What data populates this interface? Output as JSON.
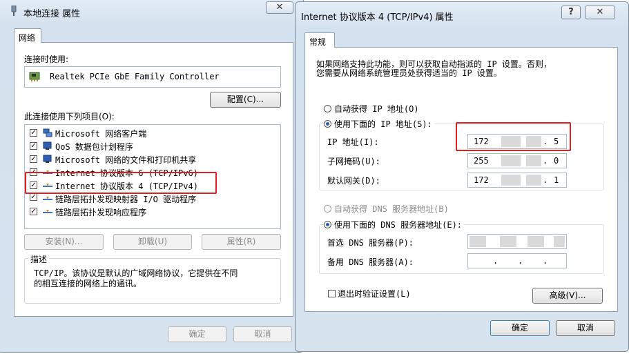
{
  "left": {
    "title": "本地连接 属性",
    "close_glyph": "✕",
    "tab": "网络",
    "connect_using_label": "连接时使用:",
    "adapter_name": "Realtek PCIe GbE Family Controller",
    "configure_button": "配置(C)...",
    "items_label": "此连接使用下列项目(O):",
    "items": [
      {
        "label": "Microsoft 网络客户端",
        "checked": true,
        "icon": "network-client-icon"
      },
      {
        "label": "QoS 数据包计划程序",
        "checked": true,
        "icon": "qos-icon"
      },
      {
        "label": "Microsoft 网络的文件和打印机共享",
        "checked": true,
        "icon": "file-printer-share-icon"
      },
      {
        "label": "Internet 协议版本 6 (TCP/IPv6)",
        "checked": true,
        "icon": "protocol-icon"
      },
      {
        "label": "Internet 协议版本 4 (TCP/IPv4)",
        "checked": true,
        "icon": "protocol-icon"
      },
      {
        "label": "链路层拓扑发现映射器 I/O 驱动程序",
        "checked": true,
        "icon": "protocol-icon"
      },
      {
        "label": "链路层拓扑发现响应程序",
        "checked": true,
        "icon": "protocol-icon"
      }
    ],
    "install_button": "安装(N)...",
    "uninstall_button": "卸载(U)",
    "properties_button": "属性(R)",
    "description_label": "描述",
    "description_text_1": "TCP/IP。该协议是默认的广域网络协议，它提供在不同",
    "description_text_2": "的相互连接的网络上的通讯。",
    "ok_button": "确定",
    "cancel_button": "取消"
  },
  "right": {
    "title": "Internet 协议版本 4 (TCP/IPv4) 属性",
    "help_glyph": "?",
    "close_glyph": "✕",
    "tab": "常规",
    "intro_1": "如果网络支持此功能，则可以获取自动指派的 IP 设置。否则，",
    "intro_2": "您需要从网络系统管理员处获得适当的 IP 设置。",
    "auto_ip_label": "自动获得 IP 地址(O)",
    "manual_ip_label": "使用下面的 IP 地址(S):",
    "ip_label": "IP 地址(I):",
    "ip_first": "172",
    "ip_last": "5",
    "subnet_label": "子网掩码(U):",
    "subnet_first": "255",
    "subnet_last": "0",
    "gateway_label": "默认网关(D):",
    "gateway_first": "172",
    "gateway_last": "1",
    "auto_dns_label": "自动获得 DNS 服务器地址(B)",
    "manual_dns_label": "使用下面的 DNS 服务器地址(E):",
    "preferred_dns_label": "首选 DNS 服务器(P):",
    "alternate_dns_label": "备用 DNS 服务器(A):",
    "dot": ".",
    "validate_label": "退出时验证设置(L)",
    "advanced_button": "高级(V)...",
    "ok_button": "确定",
    "cancel_button": "取消"
  },
  "colors": {
    "highlight": "#e02020",
    "frame": "#d7e3ef"
  }
}
